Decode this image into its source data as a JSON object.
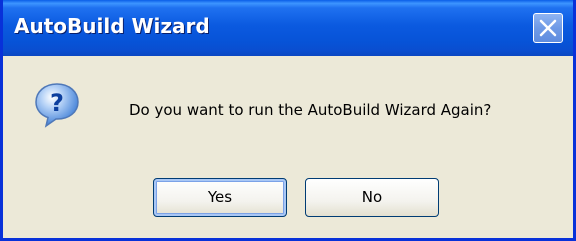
{
  "window": {
    "title": "AutoBuild Wizard"
  },
  "dialog": {
    "message": "Do you want to run the AutoBuild Wizard Again?",
    "icon": "question-icon"
  },
  "buttons": {
    "yes_label": "Yes",
    "no_label": "No"
  },
  "colors": {
    "titlebar": "#0b5ae0",
    "frame_border": "#0831d9",
    "dialog_background": "#ece9d8",
    "button_border": "#003c74",
    "icon_blue": "#3a7bd5"
  }
}
